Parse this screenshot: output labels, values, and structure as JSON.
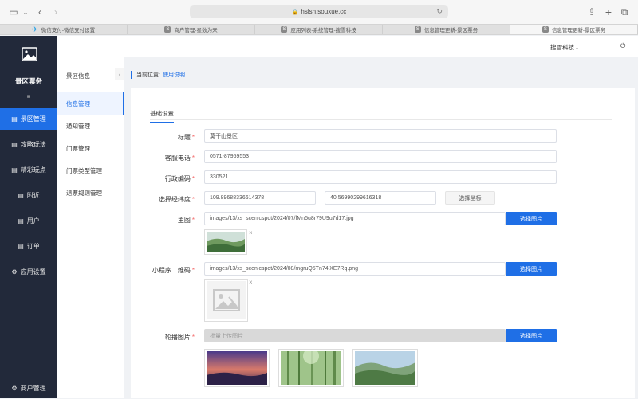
{
  "browser": {
    "url": "hslsh.souxue.cc",
    "tabs": [
      {
        "favicon": "✈",
        "title": "微信支付-微信支付设置"
      },
      {
        "favicon": "S",
        "title": "商户管理-星数为来"
      },
      {
        "favicon": "S",
        "title": "应用列表-系统管理-搜雪科技"
      },
      {
        "favicon": "S",
        "title": "信息管理更新-景区票务"
      },
      {
        "favicon": "S",
        "title": "信息管理更新-景区票务"
      }
    ]
  },
  "sidebar": {
    "app_name": "景区票务",
    "burger": "≡",
    "items": [
      {
        "label": "景区管理",
        "icon": "▤"
      },
      {
        "label": "攻略玩法",
        "icon": "▤"
      },
      {
        "label": "精彩玩点",
        "icon": "▤"
      },
      {
        "label": "附近",
        "icon": "▤"
      },
      {
        "label": "用户",
        "icon": "▤"
      },
      {
        "label": "订单",
        "icon": "▤"
      },
      {
        "label": "应用设置",
        "icon": "⚙"
      }
    ],
    "bottom_item": {
      "label": "商户管理",
      "icon": "⚙"
    }
  },
  "header": {
    "company": "搜雪科技",
    "chevron": "⌄",
    "power": "⏻"
  },
  "submenu": {
    "title": "景区信息",
    "collapse": "‹",
    "items": [
      "信息管理",
      "通知管理",
      "门票管理",
      "门票类型管理",
      "退票规则管理"
    ]
  },
  "breadcrumb": {
    "prefix": "当前位置:",
    "link": "使用说明"
  },
  "form": {
    "tab": "基础设置",
    "title": {
      "label": "标题",
      "value": "莫干山景区"
    },
    "phone": {
      "label": "客服电话",
      "value": "0571-87959553"
    },
    "region": {
      "label": "行政编码",
      "value": "330521"
    },
    "coords": {
      "label": "选择经纬度",
      "lng": "109.89688336614378",
      "lat": "40.56990299616318",
      "button": "选择坐标"
    },
    "main_image": {
      "label": "主图",
      "value": "images/13/xs_scenicspot/2024/07/fMn5u8r79U9u7d17.jpg",
      "button": "选择图片"
    },
    "qrcode": {
      "label": "小程序二维码",
      "value": "images/13/xs_scenicspot/2024/08/mgruQ5Tn74lXE7Rq.png",
      "button": "选择图片"
    },
    "carousel": {
      "label": "轮播图片",
      "placeholder": "批量上传图片",
      "button": "选择图片"
    },
    "close": "×"
  },
  "colors": {
    "primary": "#1f6fe6",
    "sidebar": "#22293a"
  }
}
